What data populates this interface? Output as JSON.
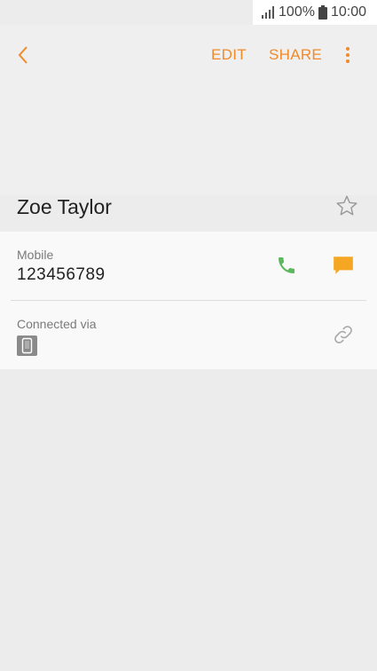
{
  "status_bar": {
    "battery": "100%",
    "time": "10:00",
    "icons": [
      "signal-icon",
      "battery-icon"
    ]
  },
  "toolbar": {
    "back_icon": "chevron-left-icon",
    "edit_label": "EDIT",
    "share_label": "SHARE",
    "more_icon": "more-vertical-icon"
  },
  "contact": {
    "name": "Zoe Taylor",
    "favorite_icon": "star-outline-icon"
  },
  "details": {
    "mobile": {
      "label": "Mobile",
      "number": "123456789",
      "call_icon": "phone-icon",
      "message_icon": "message-icon"
    },
    "connected": {
      "label": "Connected via",
      "device_icon": "phone-device-icon",
      "link_icon": "link-icon"
    }
  },
  "colors": {
    "accent": "#f08a2a",
    "call": "#5cb85c",
    "message": "#f5a623"
  }
}
